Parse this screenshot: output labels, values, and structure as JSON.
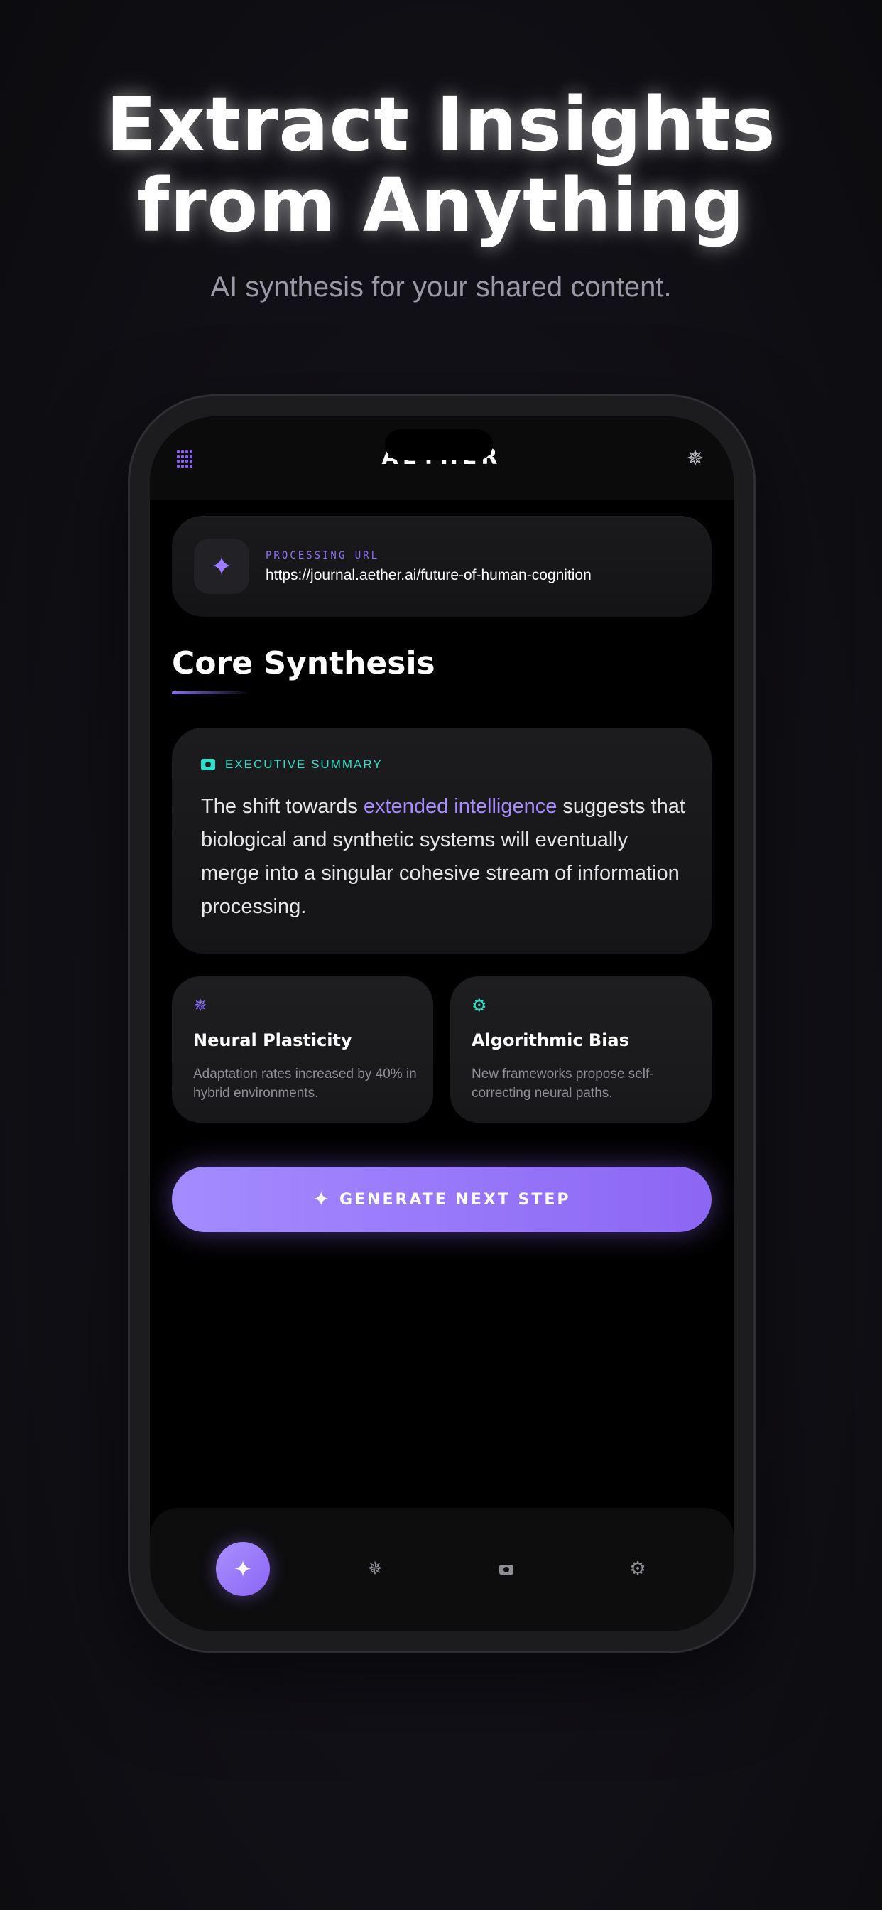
{
  "hero": {
    "title_line1": "Extract Insights",
    "title_line2": "from Anything",
    "subtitle": "AI synthesis for your shared content."
  },
  "app": {
    "brand": "AETHER",
    "menu_icon": "grid-icon",
    "top_right_icon": "sparkle-crosshair-icon"
  },
  "url_card": {
    "icon": "sparkles-icon",
    "label": "PROCESSING URL",
    "url": "https://journal.aether.ai/future-of-human-cognition"
  },
  "section": {
    "title": "Core Synthesis"
  },
  "summary": {
    "label": "EXECUTIVE SUMMARY",
    "icon": "camera-icon",
    "text_before": "The shift towards ",
    "text_highlight": "extended intelligence",
    "text_after": " suggests that biological and synthetic systems will eventually merge into a singular cohesive stream of information processing."
  },
  "insights": [
    {
      "icon": "sparkle-crosshair-icon",
      "icon_color": "#8b6cf7",
      "title": "Neural Plasticity",
      "description": "Adaptation rates increased by 40% in hybrid environments."
    },
    {
      "icon": "gear-icon",
      "icon_color": "#2ee0c9",
      "title": "Algorithmic Bias",
      "description": "New frameworks propose self-correcting neural paths."
    }
  ],
  "cta": {
    "label": "GENERATE NEXT STEP",
    "icon": "sparkles-icon"
  },
  "bottom_nav": {
    "items": [
      {
        "icon": "sparkles-icon",
        "active": true
      },
      {
        "icon": "sparkle-crosshair-icon",
        "active": false
      },
      {
        "icon": "camera-icon",
        "active": false
      },
      {
        "icon": "gear-icon",
        "active": false
      }
    ]
  },
  "colors": {
    "accent": "#8b6cf7",
    "teal": "#2ee0c9",
    "background": "#000000"
  }
}
